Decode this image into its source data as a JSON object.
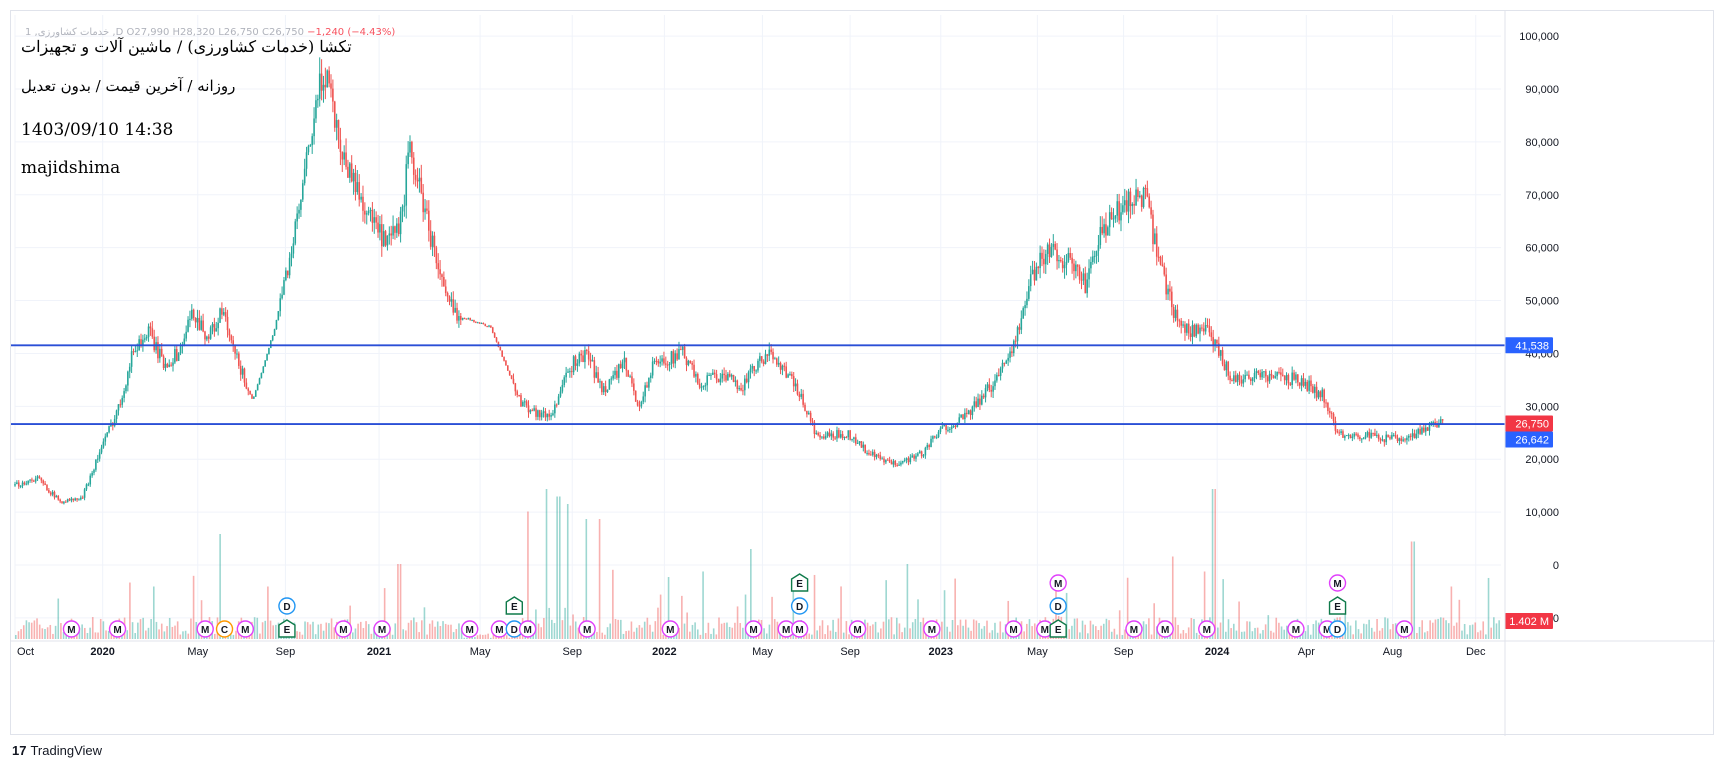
{
  "header": {
    "ohlc": {
      "symbol": "1 ,خدمات کشاورزی ,D",
      "open": "O27,990",
      "high": "H28,320",
      "low": "L26,750",
      "close": "C26,750",
      "change": "−1,240 (−4.43%)"
    },
    "title": "تکشا (خدمات کشاورزی) / ماشین آلات و تجهیزات",
    "subtitle": "روزانه / آخرین قیمت / بدون تعدیل",
    "timestamp": "1403/09/10 14:38",
    "author": "majidshima"
  },
  "branding": {
    "logo_text": "TradingView",
    "logo_mark": "17"
  },
  "colors": {
    "up": "#26a69a",
    "down": "#ef5350",
    "hline": "#2a4fd6",
    "grid": "#f0f3fa",
    "axis_text": "#131722",
    "badge_close": "#f23645",
    "badge_line": "#2962ff",
    "event_m": "#e040fb",
    "event_d": "#2196f3",
    "event_e": "#0f7a4a",
    "event_c": "#ff9800"
  },
  "chart_data": {
    "type": "candlestick",
    "timeframe": "1D",
    "ylim": [
      -14000,
      104000
    ],
    "y_ticks": [
      100000,
      90000,
      80000,
      70000,
      60000,
      50000,
      40000,
      30000,
      20000,
      10000,
      0,
      -10000
    ],
    "y_tick_labels": [
      "100,000",
      "90,000",
      "80,000",
      "70,000",
      "60,000",
      "50,000",
      "40,000",
      "30,000",
      "20,000",
      "10,000",
      "0",
      "−10,000"
    ],
    "x_ticks": [
      "Oct",
      "2020",
      "May",
      "Sep",
      "2021",
      "May",
      "Sep",
      "2022",
      "May",
      "Sep",
      "2023",
      "May",
      "Sep",
      "2024",
      "Apr",
      "Aug",
      "Dec"
    ],
    "x_tick_pos": [
      0.0,
      0.059,
      0.123,
      0.182,
      0.245,
      0.313,
      0.375,
      0.437,
      0.503,
      0.562,
      0.623,
      0.688,
      0.746,
      0.809,
      0.869,
      0.927,
      0.983
    ],
    "price_path": [
      [
        0.0,
        15000
      ],
      [
        0.015,
        16500
      ],
      [
        0.03,
        12000
      ],
      [
        0.045,
        12500
      ],
      [
        0.055,
        20000
      ],
      [
        0.07,
        30000
      ],
      [
        0.08,
        41000
      ],
      [
        0.09,
        44000
      ],
      [
        0.1,
        38000
      ],
      [
        0.11,
        40000
      ],
      [
        0.12,
        48000
      ],
      [
        0.13,
        43000
      ],
      [
        0.14,
        48000
      ],
      [
        0.145,
        42000
      ],
      [
        0.16,
        31000
      ],
      [
        0.175,
        45000
      ],
      [
        0.19,
        65000
      ],
      [
        0.2,
        82000
      ],
      [
        0.205,
        90000
      ],
      [
        0.21,
        94000
      ],
      [
        0.215,
        85000
      ],
      [
        0.22,
        78000
      ],
      [
        0.235,
        68000
      ],
      [
        0.25,
        60000
      ],
      [
        0.26,
        65000
      ],
      [
        0.265,
        78000
      ],
      [
        0.27,
        74000
      ],
      [
        0.28,
        62000
      ],
      [
        0.29,
        50000
      ],
      [
        0.3,
        47000
      ],
      [
        0.32,
        45000
      ],
      [
        0.33,
        38000
      ],
      [
        0.34,
        31000
      ],
      [
        0.35,
        29000
      ],
      [
        0.36,
        28000
      ],
      [
        0.375,
        38000
      ],
      [
        0.385,
        40000
      ],
      [
        0.395,
        33000
      ],
      [
        0.41,
        38000
      ],
      [
        0.42,
        30000
      ],
      [
        0.43,
        38000
      ],
      [
        0.45,
        40000
      ],
      [
        0.46,
        34000
      ],
      [
        0.47,
        36000
      ],
      [
        0.49,
        34000
      ],
      [
        0.5,
        38000
      ],
      [
        0.51,
        40000
      ],
      [
        0.52,
        36000
      ],
      [
        0.53,
        31000
      ],
      [
        0.54,
        24000
      ],
      [
        0.56,
        25000
      ],
      [
        0.575,
        21000
      ],
      [
        0.59,
        19000
      ],
      [
        0.61,
        21000
      ],
      [
        0.625,
        26000
      ],
      [
        0.64,
        28000
      ],
      [
        0.66,
        35000
      ],
      [
        0.675,
        44000
      ],
      [
        0.685,
        55000
      ],
      [
        0.695,
        60000
      ],
      [
        0.71,
        57000
      ],
      [
        0.72,
        53000
      ],
      [
        0.73,
        62000
      ],
      [
        0.74,
        66000
      ],
      [
        0.75,
        69000
      ],
      [
        0.76,
        70000
      ],
      [
        0.77,
        57000
      ],
      [
        0.78,
        48000
      ],
      [
        0.79,
        44000
      ],
      [
        0.8,
        45000
      ],
      [
        0.81,
        40000
      ],
      [
        0.82,
        35000
      ],
      [
        0.835,
        36000
      ],
      [
        0.85,
        35500
      ],
      [
        0.865,
        35000
      ],
      [
        0.88,
        32000
      ],
      [
        0.89,
        25000
      ],
      [
        0.905,
        24500
      ],
      [
        0.92,
        24000
      ],
      [
        0.935,
        23500
      ],
      [
        0.945,
        25000
      ],
      [
        0.955,
        27000
      ],
      [
        0.962,
        26750
      ]
    ],
    "horizontal_lines": [
      {
        "value": 41538,
        "label": "41,538"
      },
      {
        "value": 26642,
        "label": "26,642"
      }
    ],
    "last_close": {
      "value": 26750,
      "label": "26,750"
    },
    "volume_label": "1.402 M",
    "volume_peaks": [
      [
        0.093,
        0.35
      ],
      [
        0.137,
        0.7
      ],
      [
        0.17,
        0.35
      ],
      [
        0.258,
        0.5
      ],
      [
        0.345,
        0.85
      ],
      [
        0.357,
        1.0
      ],
      [
        0.365,
        0.95
      ],
      [
        0.372,
        0.9
      ],
      [
        0.384,
        0.8
      ],
      [
        0.393,
        0.8
      ],
      [
        0.495,
        0.6
      ],
      [
        0.523,
        0.4
      ],
      [
        0.6,
        0.5
      ],
      [
        0.778,
        0.55
      ],
      [
        0.8,
        0.45
      ],
      [
        0.806,
        1.0
      ],
      [
        0.823,
        0.25
      ],
      [
        0.94,
        0.65
      ],
      [
        0.966,
        0.35
      ]
    ],
    "events": [
      {
        "type": "M",
        "x": 0.038,
        "row": 0
      },
      {
        "type": "M",
        "x": 0.069,
        "row": 0
      },
      {
        "type": "M",
        "x": 0.128,
        "row": 0
      },
      {
        "type": "C",
        "x": 0.141,
        "row": 0
      },
      {
        "type": "M",
        "x": 0.155,
        "row": 0
      },
      {
        "type": "E",
        "x": 0.183,
        "row": 0
      },
      {
        "type": "D",
        "x": 0.183,
        "row": 1
      },
      {
        "type": "M",
        "x": 0.221,
        "row": 0
      },
      {
        "type": "M",
        "x": 0.247,
        "row": 0
      },
      {
        "type": "M",
        "x": 0.306,
        "row": 0
      },
      {
        "type": "M",
        "x": 0.326,
        "row": 0
      },
      {
        "type": "D",
        "x": 0.336,
        "row": 0
      },
      {
        "type": "E",
        "x": 0.336,
        "row": 1
      },
      {
        "type": "M",
        "x": 0.345,
        "row": 0
      },
      {
        "type": "M",
        "x": 0.385,
        "row": 0
      },
      {
        "type": "M",
        "x": 0.441,
        "row": 0
      },
      {
        "type": "M",
        "x": 0.497,
        "row": 0
      },
      {
        "type": "M",
        "x": 0.519,
        "row": 0
      },
      {
        "type": "M",
        "x": 0.528,
        "row": 0
      },
      {
        "type": "D",
        "x": 0.528,
        "row": 1
      },
      {
        "type": "E",
        "x": 0.528,
        "row": 2
      },
      {
        "type": "M",
        "x": 0.567,
        "row": 0
      },
      {
        "type": "M",
        "x": 0.617,
        "row": 0
      },
      {
        "type": "M",
        "x": 0.672,
        "row": 0
      },
      {
        "type": "M",
        "x": 0.693,
        "row": 0
      },
      {
        "type": "E",
        "x": 0.702,
        "row": 0
      },
      {
        "type": "D",
        "x": 0.702,
        "row": 1
      },
      {
        "type": "M",
        "x": 0.702,
        "row": 2
      },
      {
        "type": "M",
        "x": 0.753,
        "row": 0
      },
      {
        "type": "M",
        "x": 0.774,
        "row": 0
      },
      {
        "type": "M",
        "x": 0.802,
        "row": 0
      },
      {
        "type": "M",
        "x": 0.862,
        "row": 0
      },
      {
        "type": "M",
        "x": 0.883,
        "row": 0
      },
      {
        "type": "D",
        "x": 0.89,
        "row": 0
      },
      {
        "type": "E",
        "x": 0.89,
        "row": 1
      },
      {
        "type": "M",
        "x": 0.89,
        "row": 2
      },
      {
        "type": "M",
        "x": 0.935,
        "row": 0
      }
    ],
    "legend": "none",
    "grid": true
  }
}
